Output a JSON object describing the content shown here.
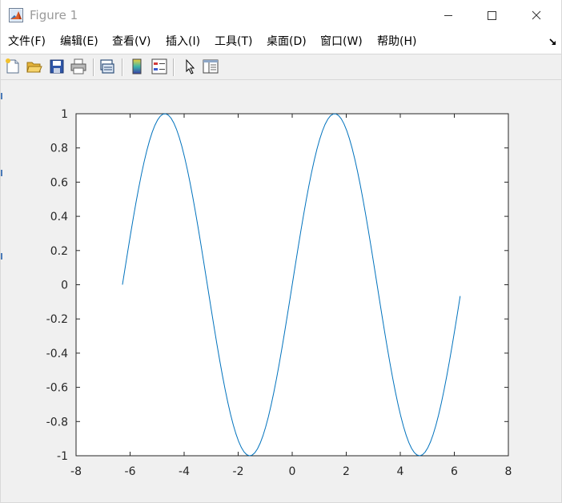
{
  "window": {
    "title": "Figure 1",
    "min_icon": "minimize-icon",
    "max_icon": "maximize-icon",
    "close_icon": "close-icon"
  },
  "menu": {
    "items": [
      {
        "label": "文件(F)"
      },
      {
        "label": "编辑(E)"
      },
      {
        "label": "查看(V)"
      },
      {
        "label": "插入(I)"
      },
      {
        "label": "工具(T)"
      },
      {
        "label": "桌面(D)"
      },
      {
        "label": "窗口(W)"
      },
      {
        "label": "帮助(H)"
      }
    ],
    "dock_icon": "dock-arrow-icon"
  },
  "toolbar": {
    "icons": [
      "new-figure-icon",
      "open-file-icon",
      "save-icon",
      "print-icon",
      "link-plot-icon",
      "insert-colorbar-icon",
      "insert-legend-icon",
      "edit-plot-icon",
      "property-inspector-icon"
    ]
  },
  "colors": {
    "line": "#0072bd",
    "axes": "#262626",
    "background": "#f0f0f0",
    "plot_bg": "#ffffff"
  },
  "chart_data": {
    "type": "line",
    "title": "",
    "xlabel": "",
    "ylabel": "",
    "xlim": [
      -8,
      8
    ],
    "ylim": [
      -1,
      1
    ],
    "xticks": [
      -8,
      -6,
      -4,
      -2,
      0,
      2,
      4,
      6,
      8
    ],
    "xtick_labels": [
      "-8",
      "-6",
      "-4",
      "-2",
      "0",
      "2",
      "4",
      "6",
      "8"
    ],
    "yticks": [
      -1,
      -0.8,
      -0.6,
      -0.4,
      -0.2,
      0,
      0.2,
      0.4,
      0.6,
      0.8,
      1
    ],
    "ytick_labels": [
      "-1",
      "-0.8",
      "-0.6",
      "-0.4",
      "-0.2",
      "0",
      "0.2",
      "0.4",
      "0.6",
      "0.8",
      "1"
    ],
    "grid": false,
    "box": true,
    "series": [
      {
        "function": "sin(x)",
        "x_start": -6.283,
        "x_end": 6.217,
        "x_step": 0.1,
        "color": "#0072bd"
      }
    ]
  }
}
